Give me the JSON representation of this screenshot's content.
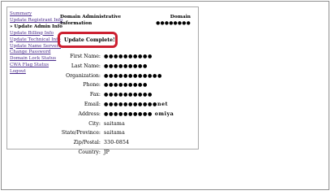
{
  "nav": {
    "items": [
      {
        "label": "Summary",
        "active": false
      },
      {
        "label": "Update Registrant Info",
        "active": false
      },
      {
        "label": "» Update Admin Info",
        "active": true
      },
      {
        "label": "Update Billing Info",
        "active": false
      },
      {
        "label": "Update Technical Info",
        "active": false
      },
      {
        "label": "Update Name Servers",
        "active": false
      },
      {
        "label": "Change Password",
        "active": false
      },
      {
        "label": "Domain Lock Status",
        "active": false
      },
      {
        "label": "CWA Flag Status",
        "active": false
      },
      {
        "label": "Logout",
        "active": false
      }
    ]
  },
  "header": {
    "title_line1": "Domain Administrative",
    "title_line2": "Information",
    "domain_label": "Domain",
    "domain_value": "●●●●●●●●"
  },
  "status": {
    "message": "Update Complete!",
    "border_color": "#cc2030"
  },
  "form": {
    "first_name": {
      "label": "First Name:",
      "value": "●●●●●●●●●●"
    },
    "last_name": {
      "label": "Last Name:",
      "value": "●●●●●●●●●"
    },
    "organization": {
      "label": "Organization:",
      "value": "●●●●●●●●●●●●"
    },
    "phone": {
      "label": "Phone:",
      "value": "●●●●●●●●●"
    },
    "fax": {
      "label": "Fax:",
      "value": "●●●●●●●●●●"
    },
    "email": {
      "label": "Email:",
      "value": "●●●●●●●●●●●net"
    },
    "address": {
      "label": "Address:",
      "value": "●●●●●●●●●● omiya"
    },
    "city": {
      "label": "City:",
      "value": "saitama"
    },
    "state": {
      "label": "State/Province:",
      "value": "saitama"
    },
    "zip": {
      "label": "Zip/Postal:",
      "value": "330-0854"
    },
    "country": {
      "label": "Country:",
      "value": "JP"
    }
  }
}
